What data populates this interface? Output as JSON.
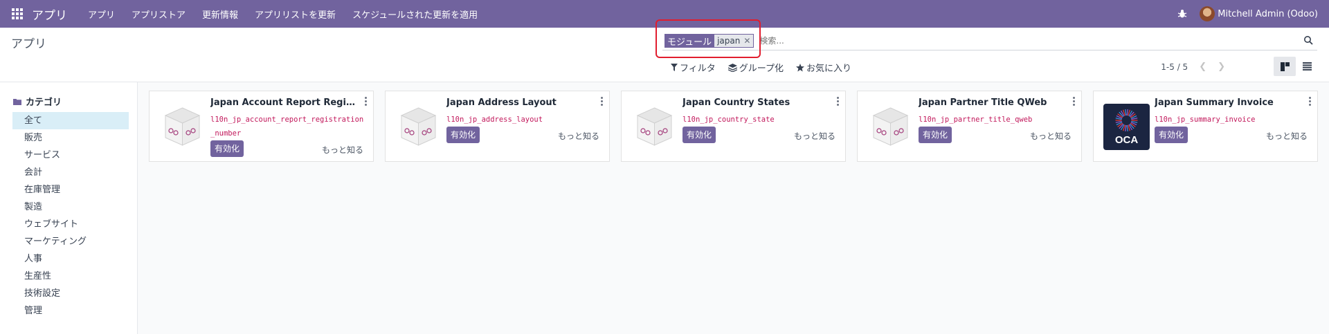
{
  "navbar": {
    "brand": "アプリ",
    "menu": [
      "アプリ",
      "アプリストア",
      "更新情報",
      "アプリリストを更新",
      "スケジュールされた更新を適用"
    ],
    "user": "Mitchell Admin (Odoo)"
  },
  "breadcrumb": "アプリ",
  "search": {
    "facet_label": "モジュール",
    "facet_value": "japan",
    "placeholder": "検索..."
  },
  "filters": {
    "filter_label": "フィルタ",
    "group_label": "グループ化",
    "favorites_label": "お気に入り"
  },
  "pager": "1-5 / 5",
  "sidebar": {
    "header": "カテゴリ",
    "items": [
      "全て",
      "販売",
      "サービス",
      "会計",
      "在庫管理",
      "製造",
      "ウェブサイト",
      "マーケティング",
      "人事",
      "生産性",
      "技術設定",
      "管理"
    ],
    "active_index": 0
  },
  "apps": [
    {
      "name": "Japan Account Report Registrati...",
      "tech": "l10n_jp_account_report_registration_number",
      "activate": "有効化",
      "learn": "もっと知る",
      "logo": "box"
    },
    {
      "name": "Japan Address Layout",
      "tech": "l10n_jp_address_layout",
      "activate": "有効化",
      "learn": "もっと知る",
      "logo": "box"
    },
    {
      "name": "Japan Country States",
      "tech": "l10n_jp_country_state",
      "activate": "有効化",
      "learn": "もっと知る",
      "logo": "box"
    },
    {
      "name": "Japan Partner Title QWeb",
      "tech": "l10n_jp_partner_title_qweb",
      "activate": "有効化",
      "learn": "もっと知る",
      "logo": "box"
    },
    {
      "name": "Japan Summary Invoice",
      "tech": "l10n_jp_summary_invoice",
      "activate": "有効化",
      "learn": "もっと知る",
      "logo": "oca"
    }
  ],
  "oca_text": "OCA",
  "colors": {
    "brand": "#71639e",
    "highlight": "#e11d2e",
    "tech_name": "#c2185b",
    "active_category": "#d9eef7"
  }
}
